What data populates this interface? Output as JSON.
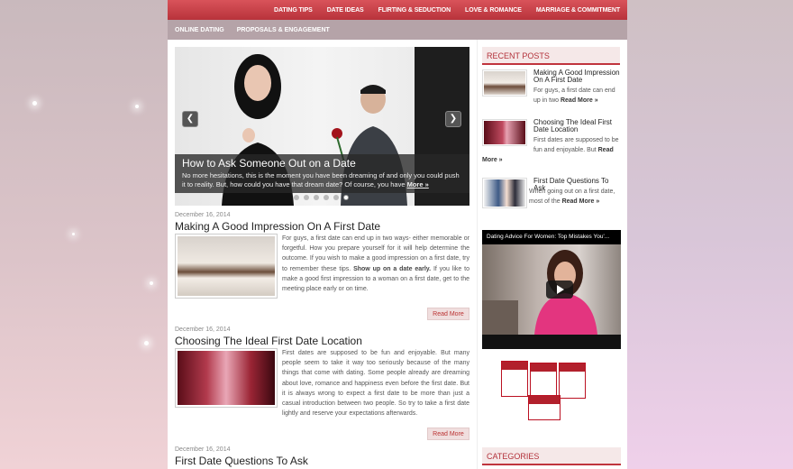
{
  "nav": {
    "top": [
      "DATING TIPS",
      "DATE IDEAS",
      "FLIRTING & SEDUCTION",
      "LOVE & ROMANCE",
      "MARRIAGE & COMMITMENT"
    ],
    "sub": [
      "ONLINE DATING",
      "PROPOSALS & ENGAGEMENT"
    ]
  },
  "slider": {
    "title": "How to Ask Someone Out on a Date",
    "text": "No more hesitations, this is the moment you have been dreaming of and only you could push it to reality. But, how could you have that dream date? Of course, you have",
    "more": "More »",
    "prev_icon": "chevron-left-icon",
    "next_icon": "chevron-right-icon",
    "dots": 6
  },
  "posts": [
    {
      "date": "December 16, 2014",
      "title": "Making A Good Impression On A First Date",
      "excerpt_a": "For guys, a first date can end up in two ways- either memorable or forgetful. How you prepare yourself for it will help determine the outcome. If you wish to make a good impression on a first date, try to remember these tips.",
      "excerpt_bold": "Show up on a date early.",
      "excerpt_b": "If you like to make a good first impression to a woman on a first date, get to the meeting place early or on time.",
      "read_more": "Read More"
    },
    {
      "date": "December 16, 2014",
      "title": "Choosing The Ideal First Date Location",
      "excerpt_a": "First dates are supposed to be fun and enjoyable. But many people seem to take it way too seriously because of the many things that come with dating. Some people already are dreaming about love, romance and happiness even before the first date. But it is always wrong to expect a first date to be more than just a casual introduction between two people. So try to take a first date lightly and reserve your expectations afterwards.",
      "read_more": "Read More"
    },
    {
      "date": "December 16, 2014",
      "title": "First Date Questions To Ask"
    }
  ],
  "sidebar": {
    "recent_title": "RECENT POSTS",
    "recent": [
      {
        "title": "Making A Good Impression On A First Date",
        "text": "For guys, a first date can end up in two",
        "more": "Read More »"
      },
      {
        "title": "Choosing The Ideal First Date Location",
        "text": "First dates are supposed to be fun and enjoyable. But",
        "more_a": "Read",
        "more_b": "More »"
      },
      {
        "title": "First Date Questions To Ask",
        "text": "When going out on a first date, most of the",
        "more": "Read More »"
      }
    ],
    "video_title": "Dating Advice For Women: Top Mistakes You'...",
    "categories_title": "CATEGORIES"
  }
}
